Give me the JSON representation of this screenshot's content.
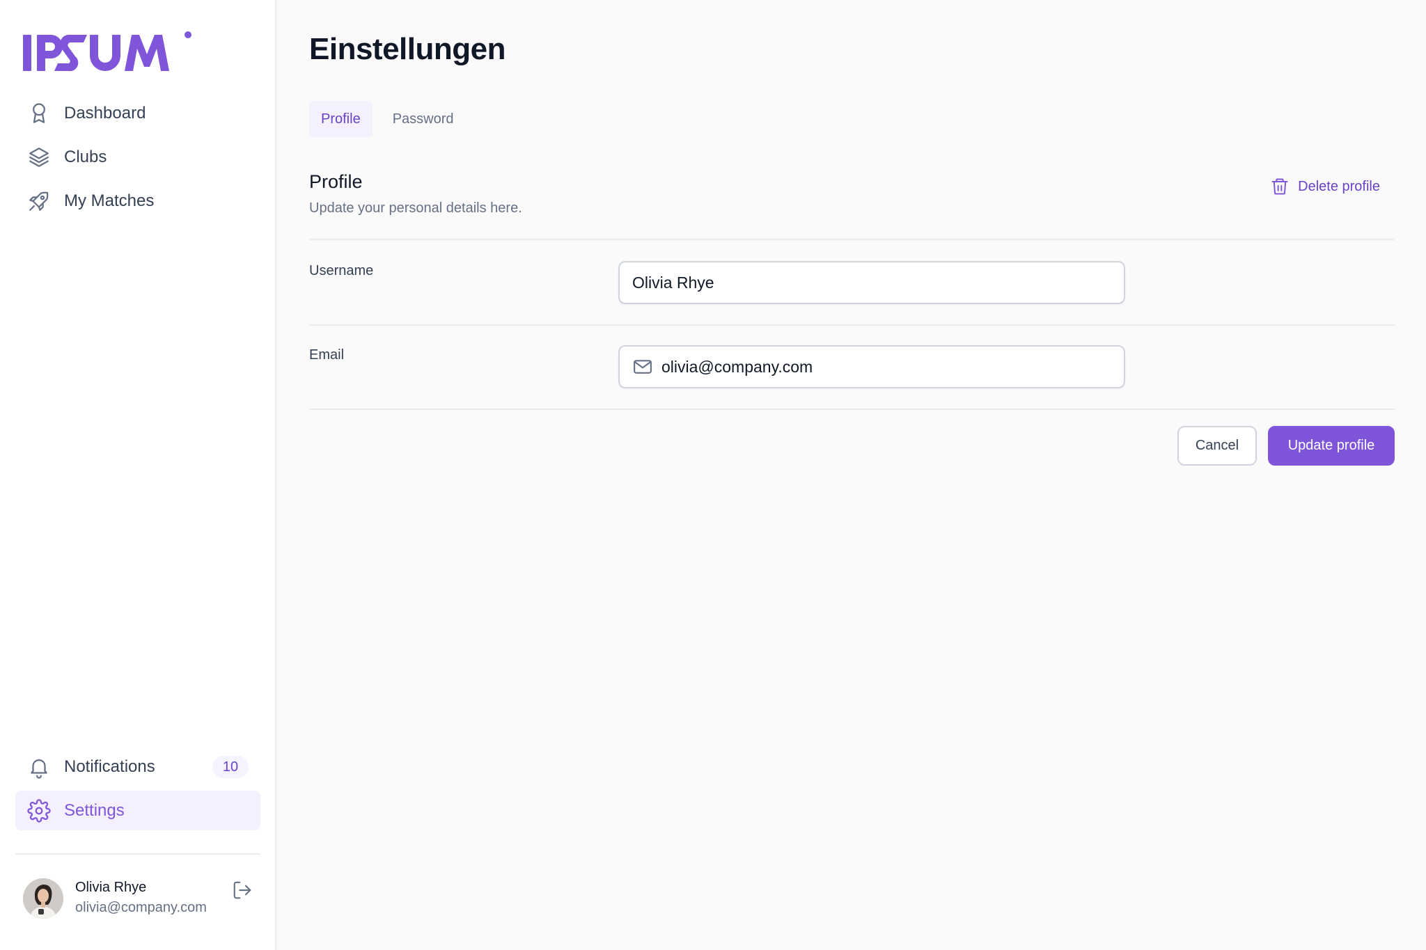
{
  "brand": {
    "logo_text": "IPSUM",
    "accent": "#7f56d9"
  },
  "sidebar": {
    "top_items": [
      {
        "label": "Dashboard",
        "icon": "award-icon"
      },
      {
        "label": "Clubs",
        "icon": "layers-icon"
      },
      {
        "label": "My Matches",
        "icon": "rocket-icon"
      }
    ],
    "bottom_items": [
      {
        "label": "Notifications",
        "icon": "bell-icon",
        "badge": "10"
      },
      {
        "label": "Settings",
        "icon": "gear-icon",
        "active": true
      }
    ],
    "account": {
      "name": "Olivia Rhye",
      "email": "olivia@company.com"
    }
  },
  "page": {
    "title": "Einstellungen",
    "tabs": [
      {
        "label": "Profile",
        "active": true
      },
      {
        "label": "Password",
        "active": false
      }
    ],
    "section": {
      "title": "Profile",
      "subtitle": "Update your personal details here.",
      "delete_label": "Delete profile"
    },
    "form": {
      "username_label": "Username",
      "username_value": "Olivia Rhye",
      "email_label": "Email",
      "email_value": "olivia@company.com"
    },
    "actions": {
      "cancel_label": "Cancel",
      "update_label": "Update profile"
    }
  }
}
